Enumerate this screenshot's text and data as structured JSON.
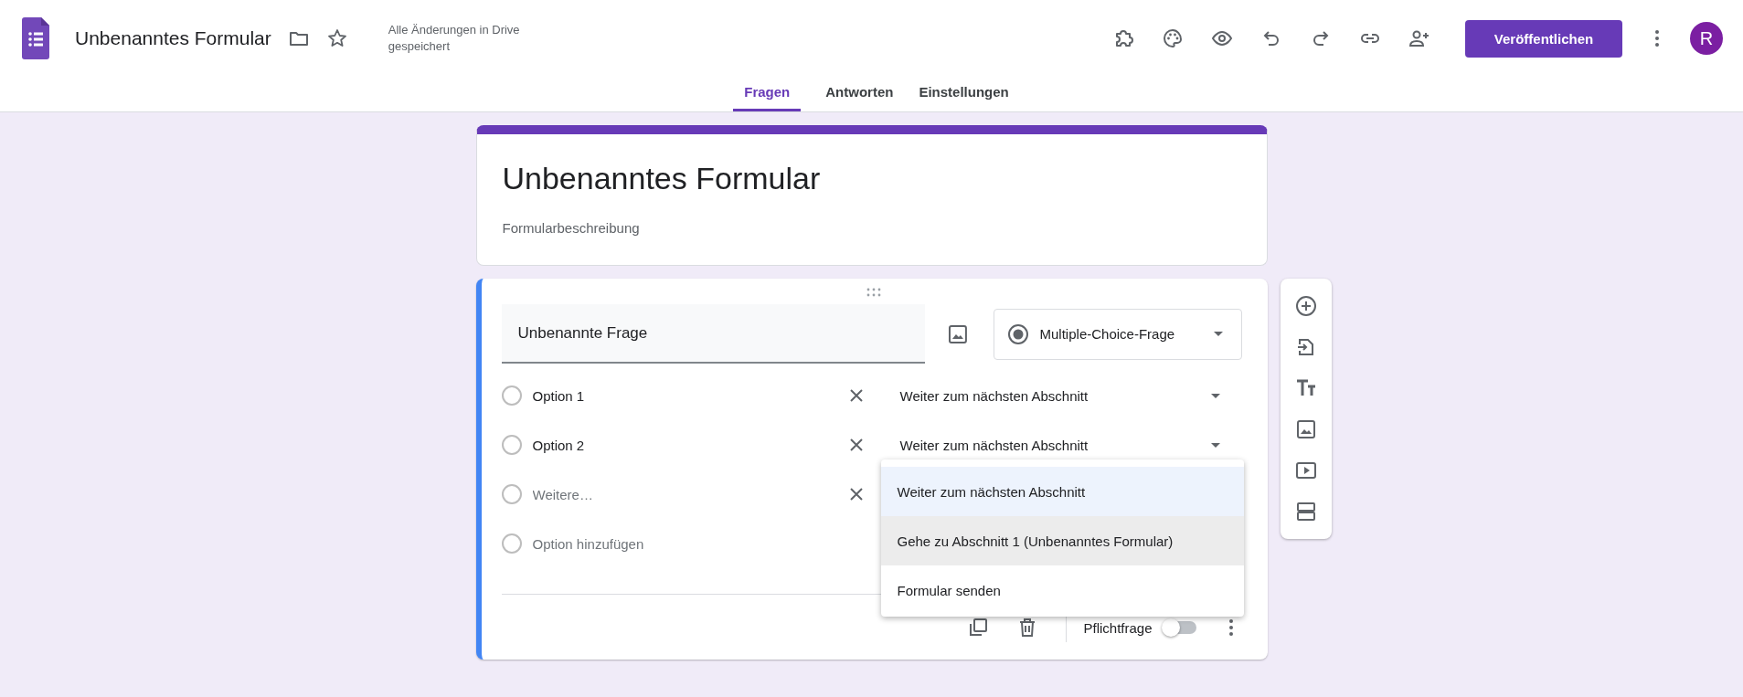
{
  "app": {
    "title": "Unbenanntes Formular",
    "save_status": "Alle Änderungen in Drive gespeichert",
    "publish_button": "Veröffentlichen",
    "avatar": "R"
  },
  "tabs": [
    {
      "label": "Fragen",
      "selected": true
    },
    {
      "label": "Antworten",
      "selected": false
    },
    {
      "label": "Einstellungen",
      "selected": false
    }
  ],
  "form": {
    "title": "Unbenanntes Formular",
    "description_placeholder": "Formularbeschreibung"
  },
  "question": {
    "title": "Unbenannte Frage",
    "type": "Multiple-Choice-Frage",
    "options": [
      {
        "kind": "option",
        "label": "Option 1",
        "checked": false,
        "destination": "Weiter zum nächsten Abschnitt"
      },
      {
        "kind": "option",
        "label": "Option 2",
        "checked": false,
        "destination": "Weiter zum nächsten Abschnitt"
      },
      {
        "kind": "draft",
        "placeholder": "Weitere…",
        "checked": false
      },
      {
        "kind": "add",
        "label": "Option hinzufügen",
        "checked": false
      }
    ],
    "required_label": "Pflichtfrage",
    "required": false
  },
  "destination_menu": [
    {
      "label": "Weiter zum nächsten Abschnitt",
      "selected": true,
      "highlighted": false
    },
    {
      "label": "Gehe zu Abschnitt 1 (Unbenanntes Formular)",
      "selected": false,
      "highlighted": true
    },
    {
      "label": "Formular senden",
      "selected": false,
      "highlighted": false
    }
  ]
}
